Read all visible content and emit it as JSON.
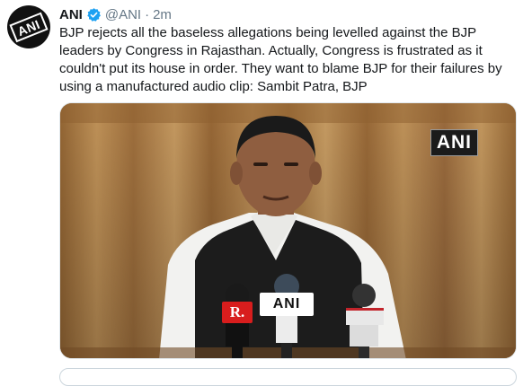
{
  "tweet": {
    "author_name": "ANI",
    "handle": "@ANI",
    "separator": "·",
    "time": "2m",
    "text": "BJP rejects all the baseless allegations being levelled against the BJP leaders by Congress in Rajasthan. Actually, Congress is frustrated as it couldn't put its house in order. They want to blame BJP for their failures by using a manufactured audio clip: Sambit Patra, BJP",
    "avatar_logo": "ANI",
    "verified_icon": "verified-badge-icon"
  },
  "media": {
    "watermark": "ANI",
    "mic_labels": {
      "center": "ANI",
      "left": "R."
    }
  },
  "colors": {
    "verified_blue": "#1da1f2",
    "text": "#14171a",
    "muted": "#657786",
    "curtain": "#b88a4f"
  }
}
